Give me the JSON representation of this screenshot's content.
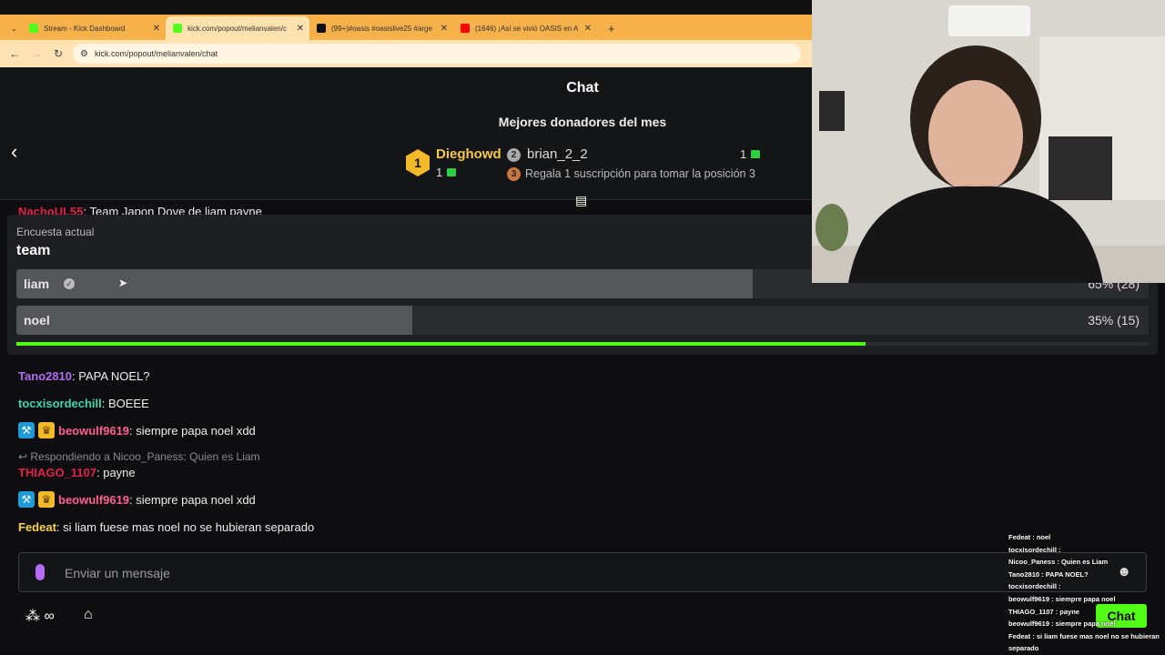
{
  "browser": {
    "tabs": [
      {
        "label": "Stream - Kick Dashboard",
        "active": false,
        "icon": "kick-icon",
        "color": "#53fc18"
      },
      {
        "label": "kick.com/popout/melianvalen/c",
        "active": true,
        "icon": "kick-icon",
        "color": "#53fc18"
      },
      {
        "label": "(99+)#oasis #oasislive25 #arge",
        "active": false,
        "icon": "tiktok-icon",
        "color": "#111111"
      },
      {
        "label": "(1646) ¡Así se vivió OASIS en A",
        "active": false,
        "icon": "youtube-icon",
        "color": "#ff0000"
      }
    ],
    "new_tab": "+",
    "url": "kick.com/popout/melianvalen/chat"
  },
  "chat": {
    "title": "Chat",
    "donors_title": "Mejores donadores del mes",
    "donor1": {
      "rank": "1",
      "name": "Dieghowd",
      "count": "1"
    },
    "donor2": {
      "rank": "2",
      "name": "brian_2_2",
      "count": "1"
    },
    "donor3": {
      "rank": "3",
      "text": "Regala 1 suscripción para tomar la posición 3"
    },
    "cutoff_user": "NachoUL55",
    "cutoff_text": ": Team Japon Dove de liam payne"
  },
  "poll": {
    "label": "Encuesta actual",
    "question": "team",
    "options": [
      {
        "label": "liam",
        "percent": 65,
        "pct_text": "65% (28)"
      },
      {
        "label": "noel",
        "percent": 35,
        "pct_text": "35% (15)"
      }
    ],
    "time_remaining_fraction": 0.75
  },
  "messages": [
    {
      "user": "Tano2810",
      "color": "#b46cf4",
      "text": ": PAPA NOEL?"
    },
    {
      "user": "tocxisordechill",
      "color": "#3fd6a6",
      "text": ": BOEEE"
    },
    {
      "user": "beowulf9619",
      "color": "#ff5f8f",
      "text": ": siempre papa noel xdd"
    },
    {
      "user": "THIAGO_1107",
      "color": "#e0224a",
      "text": ": payne",
      "reply": "Respondiendo a Nicoo_Paness: Quien es Liam"
    },
    {
      "user": "beowulf9619",
      "color": "#ff5f8f",
      "text": ": siempre papa noel xdd"
    },
    {
      "user": "Fedeat",
      "color": "#f7d24a",
      "text": ": si liam fuese mas noel no se hubieran separado"
    }
  ],
  "input": {
    "placeholder": "Enviar un mensaje",
    "points": "∞",
    "send_label": "Chat"
  },
  "overlay_chat": [
    "Fedeat : noel",
    "tocxisordechill :",
    "Nicoo_Paness : Quien es Liam",
    "Tano2810 : PAPA NOEL?",
    "tocxisordechill :",
    "beowulf9619 : siempre papa noel",
    "THIAGO_1107 : payne",
    "beowulf9619 : siempre papa noel",
    "Fedeat : si liam fuese mas noel no se hubieran",
    "separado"
  ]
}
